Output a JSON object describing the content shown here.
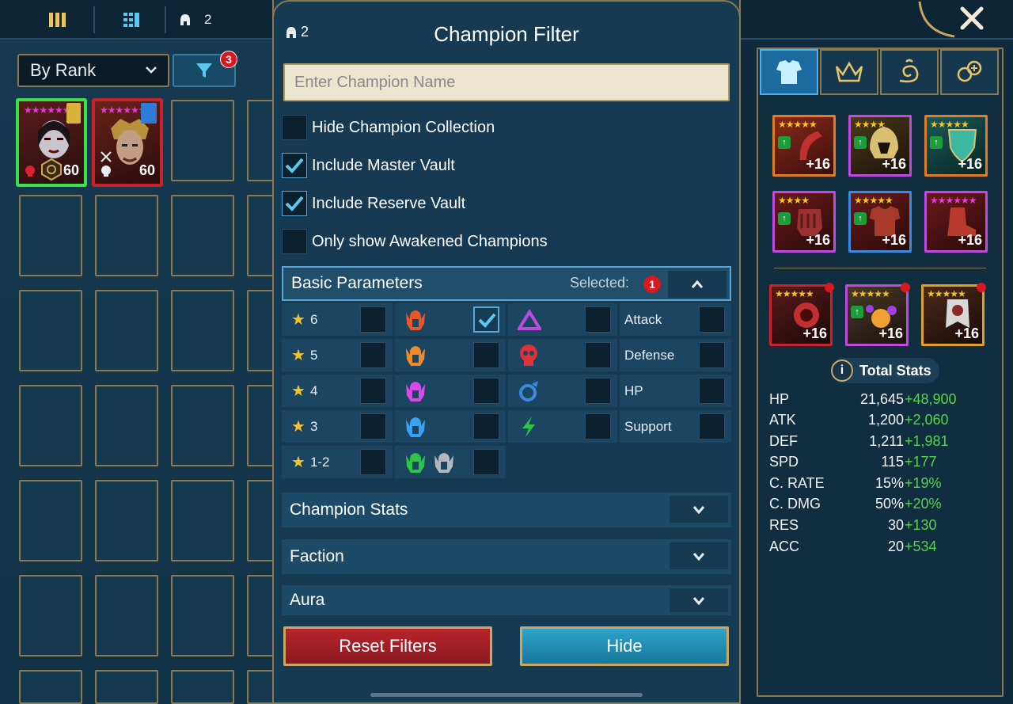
{
  "topbar": {
    "helmet_count": "2"
  },
  "left": {
    "sort_select": "By Rank",
    "filter_badge": "3",
    "champions": [
      {
        "level": "60"
      },
      {
        "level": "60"
      }
    ]
  },
  "modal": {
    "count": "2",
    "title": "Champion Filter",
    "search_placeholder": "Enter Champion Name",
    "options": [
      {
        "label": "Hide Champion Collection",
        "checked": false
      },
      {
        "label": "Include Master Vault",
        "checked": true
      },
      {
        "label": "Include Reserve Vault",
        "checked": true
      },
      {
        "label": "Only show Awakened Champions",
        "checked": false
      }
    ],
    "basic_params": {
      "title": "Basic Parameters",
      "selected_label": "Selected:",
      "selected_count": "1",
      "stars": [
        "6",
        "5",
        "4",
        "3",
        "1-2"
      ],
      "roles": [
        "Attack",
        "Defense",
        "HP",
        "Support"
      ]
    },
    "sections": [
      "Champion Stats",
      "Faction",
      "Aura"
    ],
    "reset_label": "Reset Filters",
    "hide_label": "Hide"
  },
  "right": {
    "gear_level": "+16",
    "total_stats_title": "Total Stats",
    "stats": [
      {
        "name": "HP",
        "value": "21,645",
        "bonus": "+48,900"
      },
      {
        "name": "ATK",
        "value": "1,200",
        "bonus": "+2,060"
      },
      {
        "name": "DEF",
        "value": "1,211",
        "bonus": "+1,981"
      },
      {
        "name": "SPD",
        "value": "115",
        "bonus": "+177"
      },
      {
        "name": "C. RATE",
        "value": "15%",
        "bonus": "+19%"
      },
      {
        "name": "C. DMG",
        "value": "50%",
        "bonus": "+20%"
      },
      {
        "name": "RES",
        "value": "30",
        "bonus": "+130"
      },
      {
        "name": "ACC",
        "value": "20",
        "bonus": "+534"
      }
    ]
  }
}
